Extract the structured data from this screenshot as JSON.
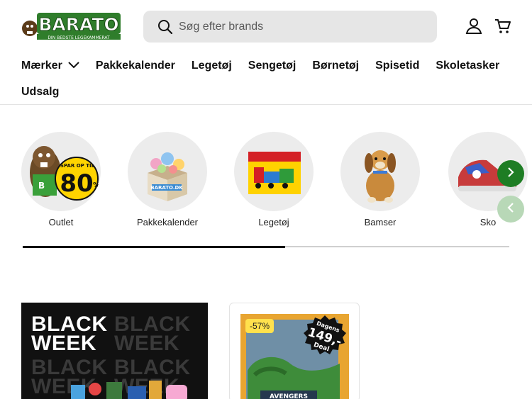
{
  "header": {
    "logo_text": "BARATO",
    "logo_tagline": "DIN BEDSTE LEGEKAMMERAT",
    "search_placeholder": "Søg efter brands",
    "icons": [
      "search-icon",
      "account-icon",
      "cart-icon",
      "chevron-down-icon"
    ]
  },
  "nav": {
    "items": [
      {
        "label": "Mærker",
        "has_dropdown": true
      },
      {
        "label": "Pakkekalender"
      },
      {
        "label": "Legetøj"
      },
      {
        "label": "Sengetøj"
      },
      {
        "label": "Børnetøj"
      },
      {
        "label": "Spisetid"
      },
      {
        "label": "Skoletasker"
      },
      {
        "label": "Udsalg"
      }
    ]
  },
  "categories": [
    {
      "label": "Outlet",
      "badge_text": "80",
      "badge_small": "SPAR OP TIL",
      "badge_unit": "%"
    },
    {
      "label": "Pakkekalender"
    },
    {
      "label": "Legetøj"
    },
    {
      "label": "Bamser"
    },
    {
      "label": "Sko"
    }
  ],
  "carousel": {
    "progress": 0.54,
    "accent": "#1e7d24",
    "accent_light": "#b8d8b7"
  },
  "promo": {
    "line1": "BLACK",
    "line2": "WEEK"
  },
  "product": {
    "discount_badge": "-57%",
    "deal_top": "Dagens",
    "deal_price": "149,-",
    "deal_bottom": "Deal"
  }
}
